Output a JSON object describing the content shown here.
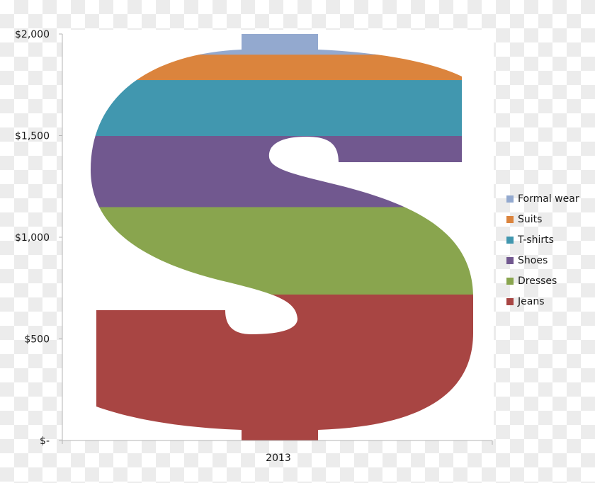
{
  "chart_data": {
    "type": "bar",
    "subtype": "stacked-column-pictograph",
    "title": "",
    "xlabel": "",
    "ylabel": "",
    "categories": [
      "2013"
    ],
    "ylim": [
      0,
      2000
    ],
    "yticks": [
      0,
      500,
      1000,
      1500,
      2000
    ],
    "ytick_labels": [
      "$-",
      "$500",
      "$1,000",
      "$1,500",
      "$2,000"
    ],
    "grid": false,
    "legend_position": "right",
    "series": [
      {
        "name": "Jeans",
        "values": [
          720
        ],
        "color": "#a84543"
      },
      {
        "name": "Dresses",
        "values": [
          430
        ],
        "color": "#89a54e"
      },
      {
        "name": "Shoes",
        "values": [
          350
        ],
        "color": "#71588f"
      },
      {
        "name": "T-shirts",
        "values": [
          275
        ],
        "color": "#4197af"
      },
      {
        "name": "Suits",
        "values": [
          125
        ],
        "color": "#db843d"
      },
      {
        "name": "Formal wear",
        "values": [
          100
        ],
        "color": "#93a9cf"
      }
    ]
  },
  "legend": {
    "items": [
      {
        "label": "Formal wear",
        "color": "#93a9cf"
      },
      {
        "label": "Suits",
        "color": "#db843d"
      },
      {
        "label": "T-shirts",
        "color": "#4197af"
      },
      {
        "label": "Shoes",
        "color": "#71588f"
      },
      {
        "label": "Dresses",
        "color": "#89a54e"
      },
      {
        "label": "Jeans",
        "color": "#a84543"
      }
    ]
  }
}
